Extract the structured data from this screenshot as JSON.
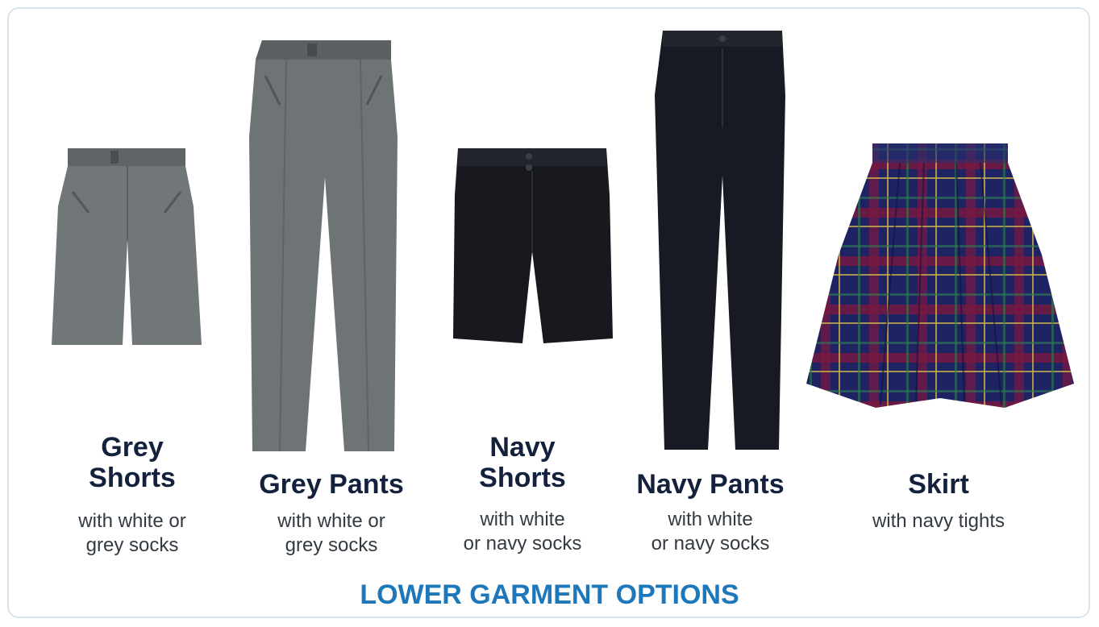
{
  "items": [
    {
      "title": "Grey\nShorts",
      "desc": "with white or\ngrey socks"
    },
    {
      "title": "Grey Pants",
      "desc": "with white or\ngrey socks"
    },
    {
      "title": "Navy\nShorts",
      "desc": "with white\nor navy socks"
    },
    {
      "title": "Navy Pants",
      "desc": "with white\nor navy socks"
    },
    {
      "title": "Skirt",
      "desc": "with navy tights"
    }
  ],
  "footer": {
    "title": "LOWER GARMENT OPTIONS"
  },
  "colors": {
    "title": "#14213d",
    "accent": "#1d77bb",
    "border": "#d6e6ec",
    "grey_fabric": "#6f7477",
    "navy_fabric": "#16181f"
  }
}
